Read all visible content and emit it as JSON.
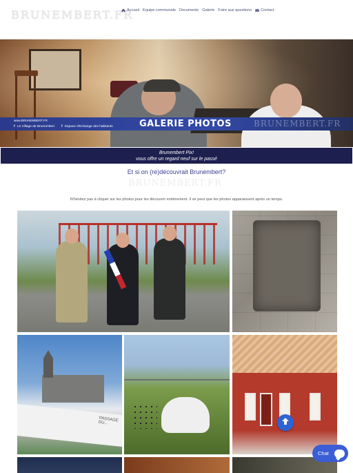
{
  "site": {
    "logo": "BRUNEMBERT.FR"
  },
  "nav": [
    {
      "label": "Accueil",
      "icon": "home-icon"
    },
    {
      "label": "Equipe communale",
      "icon": ""
    },
    {
      "label": "Documents",
      "icon": ""
    },
    {
      "label": "Galerie",
      "icon": ""
    },
    {
      "label": "Foire aux questions",
      "icon": ""
    },
    {
      "label": "Contact",
      "icon": "mail-icon"
    }
  ],
  "banner": {
    "title": "GALERIE PHOTOS",
    "watermark": "BRUNEMBERT.FR",
    "mini_logo": "www.BRUNEMBERT.FR",
    "facebook_links": [
      {
        "label": "Le Village de Brunembert"
      },
      {
        "label": "Espace d'Echange des habitants"
      }
    ]
  },
  "caption": {
    "line1": "Brunembert Pix!",
    "line2": "vous offre un regard neuf sur le passé"
  },
  "intro": {
    "title": "Et si on (re)découvrait Brunembert?",
    "watermark": "BRUNEMBERT.FR",
    "text": "N'hésitez pas à cliquer sur les photos pour les découvrir entièrement. Il se peut que les photos apparaissent après un temps."
  },
  "photos": {
    "sign_text": "PASSAGE DU..."
  },
  "chat": {
    "label": "Chat"
  },
  "colors": {
    "nav_text": "#4a4f7a",
    "title_bar": "#334aa8",
    "caption_bg": "#1d1f4f",
    "intro_title": "#3a3f8f",
    "chat_bg": "#3b5dd6",
    "scroll_up_bg": "#2f63d4"
  }
}
